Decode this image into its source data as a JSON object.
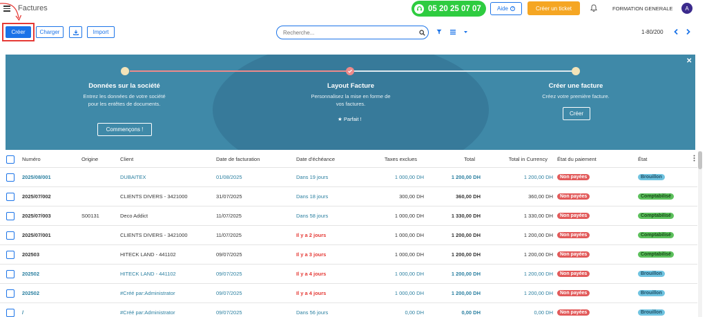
{
  "topbar": {
    "title": "Factures",
    "phone": "05 20 25 07 07",
    "aide_label": "Aide",
    "ticket_label": "Créer un ticket",
    "company": "FORMATION GENERALE",
    "avatar_letter": "A",
    "phone_color": "#2ecc40",
    "ticket_color": "#f5a623"
  },
  "toolbar": {
    "creer_label": "Créer",
    "charger_label": "Charger",
    "download_icon": "download-icon",
    "import_label": "Import",
    "search_placeholder": "Recherche...",
    "pager_text": "1-80/200"
  },
  "banner": {
    "steps": [
      {
        "title": "Données sur la société",
        "text": "Entrez les données de votre société pour les entêtes de documents.",
        "button": "Commençons !"
      },
      {
        "title": "Layout Facture",
        "text": "Personnalisez la mise en forme de vos factures.",
        "status": "Parfait !"
      },
      {
        "title": "Créer une facture",
        "text": "Créez votre première facture.",
        "button": "Créer"
      }
    ]
  },
  "table": {
    "headers": [
      "Numéro",
      "Origine",
      "Client",
      "Date de facturation",
      "Date d'échéance",
      "Taxes exclues",
      "Total",
      "Total in Currency",
      "État du paiement",
      "État"
    ],
    "rows": [
      {
        "numero": "2025/08/001",
        "origine": "",
        "client": "DUBAITEX",
        "date_fact": "01/08/2025",
        "echeance": "Dans 19 jours",
        "ht": "1 000,00 DH",
        "total": "1 200,00 DH",
        "devise": "1 200,00 DH",
        "paiement": "Non payées",
        "etat": "Brouillon"
      },
      {
        "numero": "2025/07/002",
        "origine": "",
        "client": "CLIENTS DIVERS - 3421000",
        "date_fact": "31/07/2025",
        "echeance": "Dans 18 jours",
        "ht": "300,00 DH",
        "total": "360,00 DH",
        "devise": "360,00 DH",
        "paiement": "Non payées",
        "etat": "Comptabilisé"
      },
      {
        "numero": "2025/07/003",
        "origine": "S00131",
        "client": "Deco Addict",
        "date_fact": "11/07/2025",
        "echeance": "Dans 58 jours",
        "ht": "1 000,00 DH",
        "total": "1 330,00 DH",
        "devise": "1 330,00 DH",
        "paiement": "Non payées",
        "etat": "Comptabilisé"
      },
      {
        "numero": "2025/07/001",
        "origine": "",
        "client": "CLIENTS DIVERS - 3421000",
        "date_fact": "11/07/2025",
        "echeance": "Il y a 2 jours",
        "ht": "1 000,00 DH",
        "total": "1 200,00 DH",
        "devise": "1 200,00 DH",
        "paiement": "Non payées",
        "etat": "Comptabilisé"
      },
      {
        "numero": "202503",
        "origine": "",
        "client": "HITECK LAND - 441102",
        "date_fact": "09/07/2025",
        "echeance": "Il y a 3 jours",
        "ht": "1 000,00 DH",
        "total": "1 200,00 DH",
        "devise": "1 200,00 DH",
        "paiement": "Non payées",
        "etat": "Comptabilisé"
      },
      {
        "numero": "202502",
        "origine": "",
        "client": "HITECK LAND - 441102",
        "date_fact": "09/07/2025",
        "echeance": "Il y a 4 jours",
        "ht": "1 000,00 DH",
        "total": "1 200,00 DH",
        "devise": "1 200,00 DH",
        "paiement": "Non payées",
        "etat": "Brouillon"
      },
      {
        "numero": "202502",
        "origine": "",
        "client": "#Créé par:Administrator",
        "date_fact": "09/07/2025",
        "echeance": "Il y a 4 jours",
        "ht": "1 000,00 DH",
        "total": "1 200,00 DH",
        "devise": "1 200,00 DH",
        "paiement": "Non payées",
        "etat": "Brouillon"
      },
      {
        "numero": "/",
        "origine": "",
        "client": "#Créé par:Administrator",
        "date_fact": "09/07/2025",
        "echeance": "Dans 56 jours",
        "ht": "0,00 DH",
        "total": "0,00 DH",
        "devise": "0,00 DH",
        "paiement": "Non payées",
        "etat": "Brouillon"
      }
    ]
  }
}
